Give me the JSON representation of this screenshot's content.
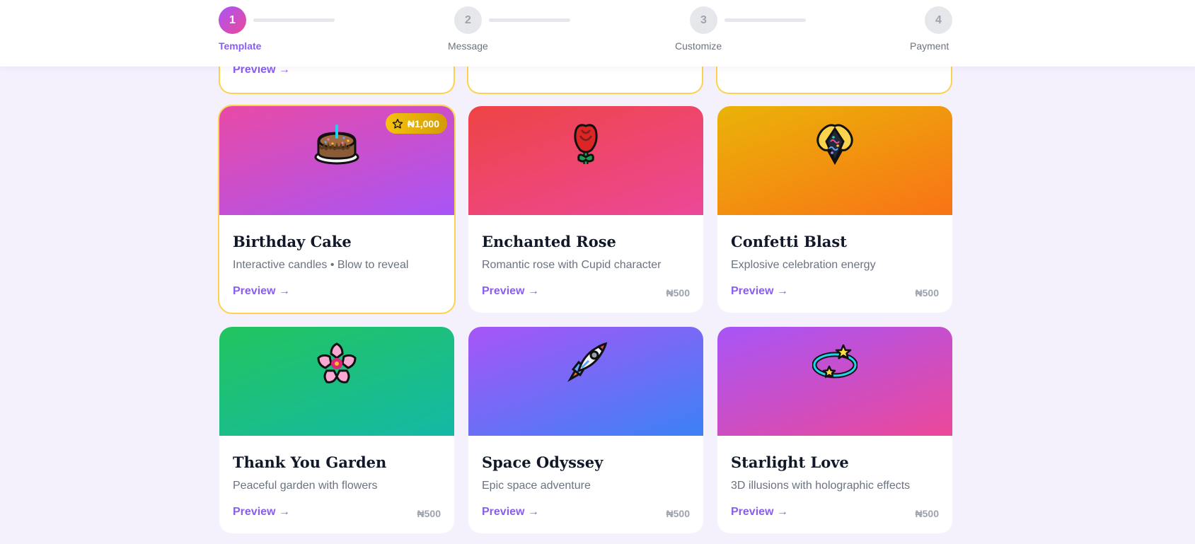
{
  "stepper": {
    "steps": [
      {
        "number": "1",
        "label": "Template",
        "active": true
      },
      {
        "number": "2",
        "label": "Message",
        "active": false
      },
      {
        "number": "3",
        "label": "Customize",
        "active": false
      },
      {
        "number": "4",
        "label": "Payment",
        "active": false
      }
    ]
  },
  "partial_row": {
    "first_preview_label": "Preview →"
  },
  "templates": [
    {
      "title": "Birthday Cake",
      "description": "Interactive candles • Blow to reveal",
      "preview_label": "Preview →",
      "price": "",
      "badge": "₦1,000",
      "icon": "birthday-cake-icon",
      "gradient": [
        "#e94aa6",
        "#a855f7"
      ],
      "selected": true
    },
    {
      "title": "Enchanted Rose",
      "description": "Romantic rose with Cupid character",
      "preview_label": "Preview →",
      "price": "₦500",
      "badge": "",
      "icon": "rose-icon",
      "gradient": [
        "#ef4444",
        "#ec4899"
      ],
      "selected": false
    },
    {
      "title": "Confetti Blast",
      "description": "Explosive celebration energy",
      "preview_label": "Preview →",
      "price": "₦500",
      "badge": "",
      "icon": "confetti-popper-icon",
      "gradient": [
        "#eab308",
        "#f97316"
      ],
      "selected": false
    },
    {
      "title": "Thank You Garden",
      "description": "Peaceful garden with flowers",
      "preview_label": "Preview →",
      "price": "₦500",
      "badge": "",
      "icon": "cherry-blossom-icon",
      "gradient": [
        "#22c55e",
        "#14b8a6"
      ],
      "selected": false
    },
    {
      "title": "Space Odyssey",
      "description": "Epic space adventure",
      "preview_label": "Preview →",
      "price": "₦500",
      "badge": "",
      "icon": "rocket-icon",
      "gradient": [
        "#a855f7",
        "#3b82f6"
      ],
      "selected": false
    },
    {
      "title": "Starlight Love",
      "description": "3D illusions with holographic effects",
      "preview_label": "Preview →",
      "price": "₦500",
      "badge": "",
      "icon": "dizzy-star-icon",
      "gradient": [
        "#a855f7",
        "#ec4899"
      ],
      "selected": false
    }
  ],
  "colors": {
    "accent": "#8b5cf6",
    "selected_border": "#fcd34d",
    "background": "#f4f1fd"
  }
}
